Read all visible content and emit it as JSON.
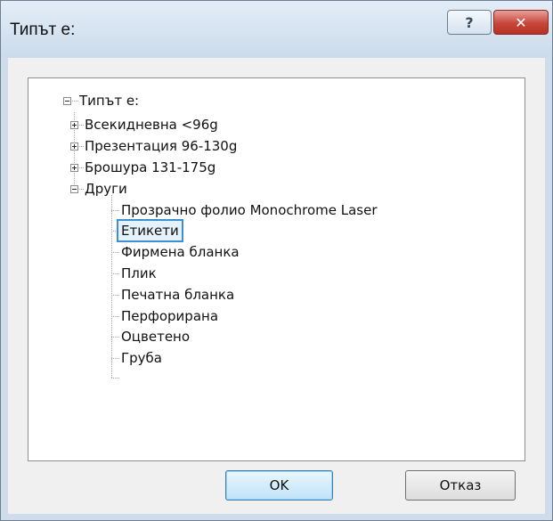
{
  "window": {
    "title": "Типът е:",
    "help_glyph": "?",
    "close_glyph": "✕"
  },
  "tree": {
    "root": {
      "label": "Типът е:",
      "expanded": true
    },
    "categories": [
      {
        "label": "Всекидневна <96g",
        "expanded": false
      },
      {
        "label": "Презентация 96-130g",
        "expanded": false
      },
      {
        "label": "Брошура 131-175g",
        "expanded": false
      },
      {
        "label": "Други",
        "expanded": true
      }
    ],
    "other_items": [
      "Прозрачно фолио Monochrome Laser",
      "Етикети",
      "Фирмена бланка",
      "Плик",
      "Печатна бланка",
      "Перфорирана",
      "Оцветено",
      "Груба"
    ],
    "selected": "Етикети"
  },
  "buttons": {
    "ok": "OK",
    "cancel": "Отказ"
  },
  "colors": {
    "selection_border": "#3d8fd6",
    "close_button": "#c7463a"
  }
}
